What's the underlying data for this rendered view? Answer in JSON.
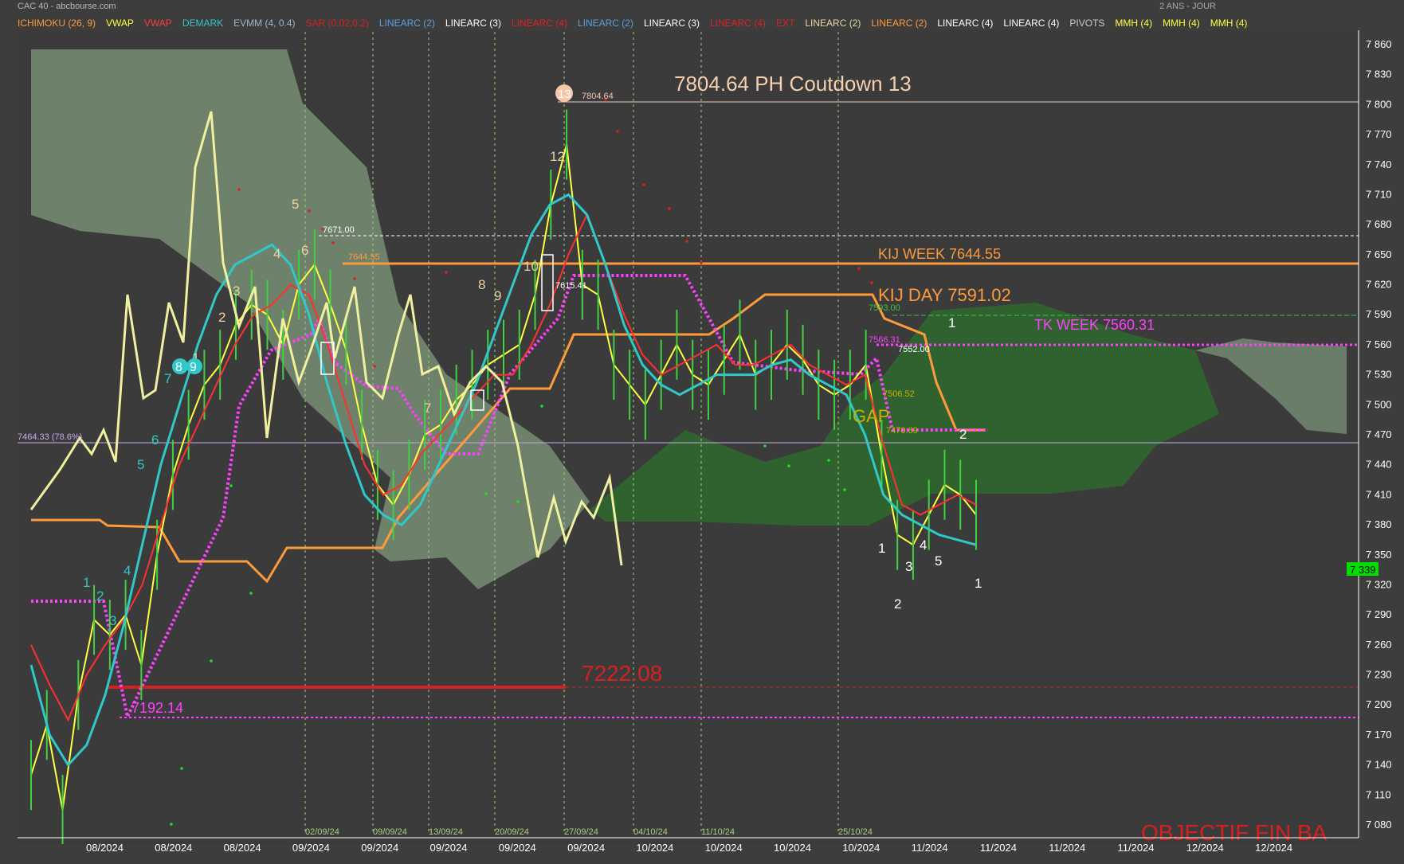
{
  "header": {
    "source": "CAC 40 - abcbourse.com",
    "mode": "2 ANS - JOUR"
  },
  "legend": [
    {
      "label": "ICHIMOKU (26, 9)",
      "color": "#ff9a3c"
    },
    {
      "label": "VWAP",
      "color": "#ffff40"
    },
    {
      "label": "VWAP",
      "color": "#ff3c3c"
    },
    {
      "label": "DEMARK",
      "color": "#30c8c8"
    },
    {
      "label": "EVMM (4, 0.4)",
      "color": "#9fb6c8"
    },
    {
      "label": "SAR (0.02,0.2)",
      "color": "#d62020"
    },
    {
      "label": "LINEARC (2)",
      "color": "#5aa0e0"
    },
    {
      "label": "LINEARC (3)",
      "color": "#ffffff"
    },
    {
      "label": "LINEARC (4)",
      "color": "#e02020"
    },
    {
      "label": "LINEARC (2)",
      "color": "#5aa0e0"
    },
    {
      "label": "LINEARC (3)",
      "color": "#ffffff"
    },
    {
      "label": "LINEARC (4)",
      "color": "#e02020"
    },
    {
      "label": "EXT",
      "color": "#e02020"
    },
    {
      "label": "LINEARC (2)",
      "color": "#e8d8a0"
    },
    {
      "label": "LINEARC (2)",
      "color": "#ff9a3c"
    },
    {
      "label": "LINEARC (4)",
      "color": "#ffffff"
    },
    {
      "label": "LINEARC (4)",
      "color": "#ffffff"
    },
    {
      "label": "PIVOTS",
      "color": "#cccccc"
    },
    {
      "label": "MMH (4)",
      "color": "#ffff40"
    },
    {
      "label": "MMH (4)",
      "color": "#ffff40"
    },
    {
      "label": "MMH (4)",
      "color": "#ffff40"
    }
  ],
  "chart_data": {
    "type": "line",
    "title": "7804.64 PH Coutdown 13",
    "ylim": [
      7080,
      7890
    ],
    "yticks": [
      7860,
      7830,
      7800,
      7770,
      7740,
      7710,
      7680,
      7650,
      7620,
      7590,
      7560,
      7530,
      7500,
      7470,
      7440,
      7410,
      7380,
      7350,
      7320,
      7290,
      7260,
      7230,
      7200,
      7170,
      7140,
      7110,
      7080
    ],
    "xticks": [
      "08/2024",
      "08/2024",
      "08/2024",
      "09/2024",
      "09/2024",
      "09/2024",
      "09/2024",
      "09/2024",
      "10/2024",
      "10/2024",
      "10/2024",
      "10/2024",
      "11/2024",
      "11/2024",
      "11/2024",
      "11/2024",
      "12/2024",
      "12/2024"
    ],
    "vline_labels": [
      "02/09/24",
      "09/09/24",
      "13/09/24",
      "20/09/24",
      "27/09/24",
      "04/10/24",
      "11/10/24",
      "25/10/24"
    ],
    "last_price": {
      "value": 7339,
      "label": "7 339"
    },
    "series": [
      {
        "color": "#ffff40",
        "values": [
          7130,
          7180,
          7095,
          7210,
          7285,
          7270,
          7290,
          7240,
          7350,
          7430,
          7480,
          7520,
          7540,
          7580,
          7600,
          7590,
          7560,
          7620,
          7640,
          7600,
          7555,
          7480,
          7420,
          7400,
          7430,
          7470,
          7480,
          7505,
          7520,
          7540,
          7550,
          7560,
          7610,
          7700,
          7760,
          7620,
          7610,
          7540,
          7520,
          7500,
          7530,
          7560,
          7530,
          7520,
          7545,
          7570,
          7530,
          7540,
          7560,
          7545,
          7520,
          7510,
          7520,
          7540,
          7450,
          7370,
          7360,
          7390,
          7420,
          7410,
          7390
        ]
      },
      {
        "color": "#ff3030",
        "values": [
          7260,
          7220,
          7185,
          7230,
          7260,
          7285,
          7320,
          7380,
          7440,
          7480,
          7520,
          7560,
          7590,
          7600,
          7620,
          7610,
          7560,
          7500,
          7440,
          7410,
          7420,
          7450,
          7470,
          7490,
          7510,
          7530,
          7530,
          7560,
          7600,
          7650,
          7690,
          7640,
          7590,
          7550,
          7530,
          7540,
          7550,
          7560,
          7540,
          7540,
          7550,
          7560,
          7540,
          7530,
          7520,
          7530,
          7460,
          7400,
          7390,
          7400,
          7410,
          7400
        ]
      },
      {
        "color": "#30c8c8",
        "values": [
          7240,
          7170,
          7140,
          7160,
          7210,
          7280,
          7360,
          7440,
          7500,
          7560,
          7610,
          7640,
          7650,
          7660,
          7640,
          7590,
          7520,
          7460,
          7410,
          7390,
          7380,
          7400,
          7440,
          7480,
          7520,
          7570,
          7620,
          7670,
          7700,
          7710,
          7690,
          7640,
          7580,
          7540,
          7520,
          7510,
          7520,
          7530,
          7530,
          7530,
          7540,
          7545,
          7530,
          7520,
          7510,
          7470,
          7410,
          7390,
          7380,
          7370,
          7365,
          7360
        ]
      }
    ]
  },
  "labels": {
    "kij_week": "KIJ WEEK 7644.55",
    "kij_day": "KIJ DAY 7591.02",
    "tk_week": "TK WEEK 7560.31",
    "gap": "GAP",
    "red_level": "7222.08",
    "magenta_level": "7192.14",
    "fib": "7464.33  (78.6%)",
    "ph": "7804.64",
    "pivot": "7671.00",
    "kij_small": "7644.55",
    "p7615": "7615.41",
    "p7593": "7593.00",
    "p7566": "7566.31",
    "p7552": "7552.00",
    "p7506": "7506.52",
    "p7470": "7470.69",
    "bottom_text": "OBJECTIF FIN BA"
  }
}
